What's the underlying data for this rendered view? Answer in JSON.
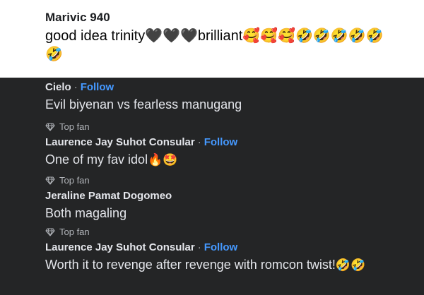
{
  "top_comment": {
    "author": "Marivic 940",
    "text": "good idea trinity🖤🖤🖤brilliant🥰🥰🥰🤣🤣🤣🤣🤣🤣"
  },
  "comments": [
    {
      "author": "Cielo",
      "follow": "Follow",
      "text": "Evil biyenan vs fearless manugang"
    },
    {
      "badge": "Top fan",
      "author": "Laurence Jay Suhot Consular",
      "follow": "Follow",
      "text": "One of my fav idol",
      "emojis": "🔥🤩"
    },
    {
      "badge": "Top fan",
      "author": "Jeraline Pamat Dogomeo",
      "text": "Both magaling"
    },
    {
      "badge": "Top fan",
      "author": "Laurence Jay Suhot Consular",
      "follow": "Follow",
      "text": "Worth it to revenge after revenge with romcon twist!",
      "emojis": "🤣🤣"
    }
  ],
  "separator": "·",
  "icons": {
    "badge": "diamond-icon"
  },
  "colors": {
    "follow": "#4599ff",
    "dark_bg": "#242526",
    "text": "#e4e6eb",
    "muted": "#b0b3b8"
  }
}
